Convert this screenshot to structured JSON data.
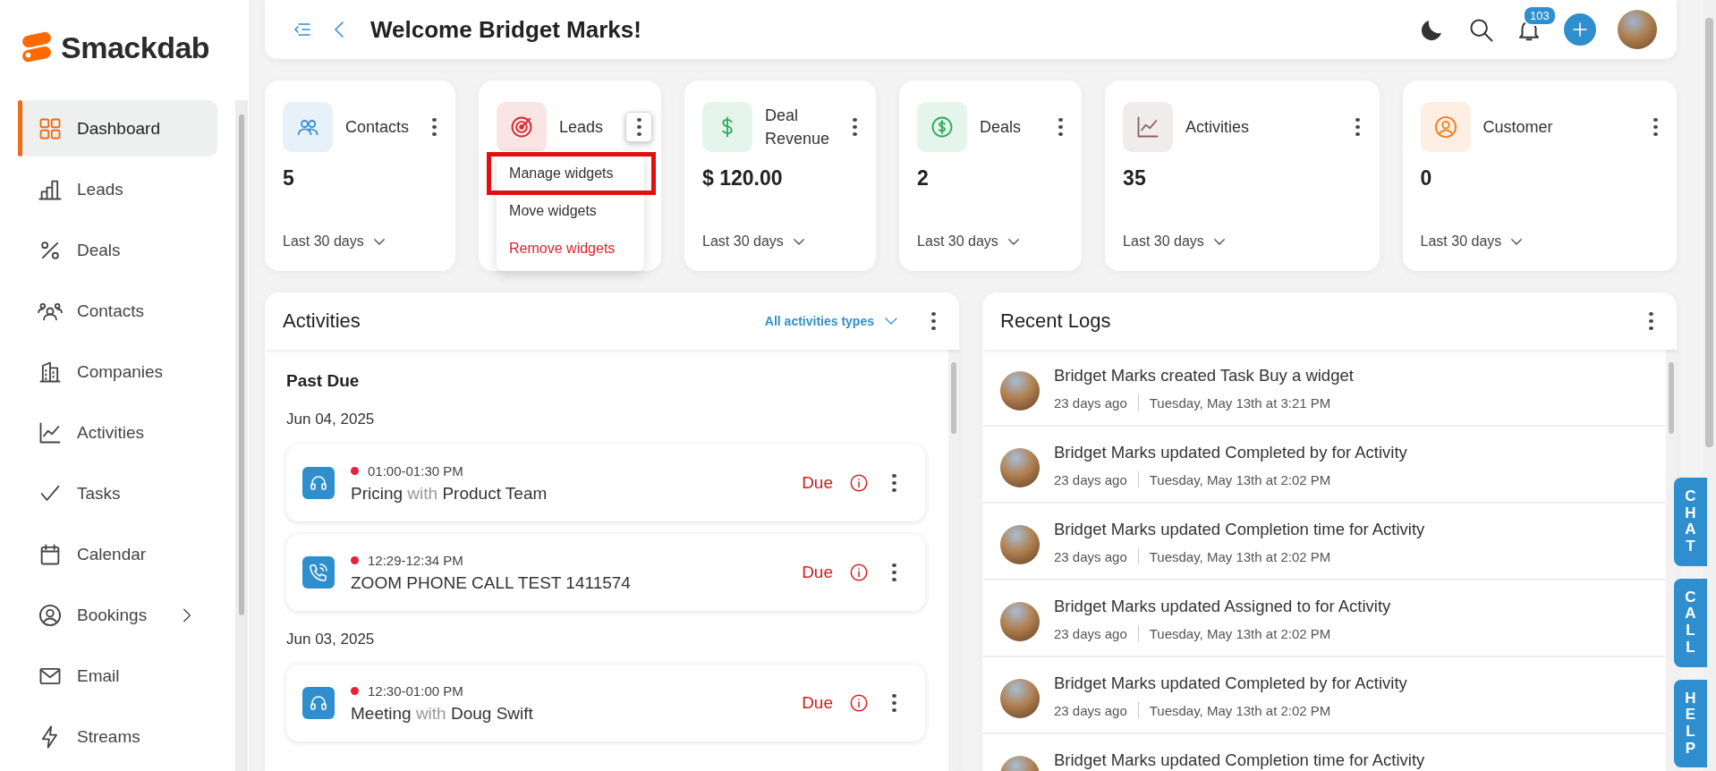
{
  "app": {
    "logo": "Smackdab"
  },
  "sidebar": {
    "items": [
      {
        "label": "Dashboard",
        "selected": true,
        "has_submenu": false
      },
      {
        "label": "Leads",
        "selected": false,
        "has_submenu": false
      },
      {
        "label": "Deals",
        "selected": false,
        "has_submenu": false
      },
      {
        "label": "Contacts",
        "selected": false,
        "has_submenu": false
      },
      {
        "label": "Companies",
        "selected": false,
        "has_submenu": false
      },
      {
        "label": "Activities",
        "selected": false,
        "has_submenu": false
      },
      {
        "label": "Tasks",
        "selected": false,
        "has_submenu": false
      },
      {
        "label": "Calendar",
        "selected": false,
        "has_submenu": false
      },
      {
        "label": "Bookings",
        "selected": false,
        "has_submenu": true
      },
      {
        "label": "Email",
        "selected": false,
        "has_submenu": false
      },
      {
        "label": "Streams",
        "selected": false,
        "has_submenu": false
      }
    ]
  },
  "header": {
    "title": "Welcome Bridget Marks!",
    "notification_count": "103"
  },
  "widgets": [
    {
      "title": "Contacts",
      "value": "5",
      "period": "Last 30 days",
      "color": "#3b8fd0",
      "menu_open": false
    },
    {
      "title": "Leads",
      "color": "#d9262d",
      "menu_open": true
    },
    {
      "title": "Deal Revenue",
      "value": "$ 120.00",
      "period": "Last 30 days",
      "color": "#2eaa5c",
      "menu_open": false
    },
    {
      "title": "Deals",
      "value": "2",
      "period": "Last 30 days",
      "color": "#2eaa5c",
      "menu_open": false
    },
    {
      "title": "Activities",
      "value": "35",
      "period": "Last 30 days",
      "color": "#8a6464",
      "menu_open": false
    },
    {
      "title": "Customer",
      "value": "0",
      "period": "Last 30 days",
      "color": "#f07f1e",
      "menu_open": false
    }
  ],
  "widget_menu": {
    "items": [
      {
        "label": "Manage widgets",
        "kind": "normal",
        "highlighted": true
      },
      {
        "label": "Move widgets",
        "kind": "normal",
        "highlighted": false
      },
      {
        "label": "Remove widgets",
        "kind": "danger",
        "highlighted": false
      }
    ]
  },
  "activities": {
    "title": "Activities",
    "filter": "All activities types",
    "section": "Past Due",
    "groups": [
      {
        "date": "Jun 04, 2025",
        "items": [
          {
            "kind": "meeting",
            "time": "01:00-01:30 PM",
            "subject": "Pricing",
            "joiner": "with",
            "contact": "Product Team",
            "status": "Due",
            "overdue": true
          },
          {
            "kind": "call",
            "time": "12:29-12:34 PM",
            "subject": "ZOOM PHONE CALL TEST 1411574",
            "status": "Due",
            "overdue": true
          }
        ]
      },
      {
        "date": "Jun 03, 2025",
        "items": [
          {
            "kind": "meeting",
            "time": "12:30-01:00 PM",
            "subject": "Meeting",
            "joiner": "with",
            "contact": "Doug Swift",
            "status": "Due",
            "overdue": true
          }
        ]
      }
    ]
  },
  "recent_logs": {
    "title": "Recent Logs",
    "items": [
      {
        "text": "Bridget Marks created Task Buy a widget",
        "ago": "23 days ago",
        "time": "Tuesday, May 13th at 3:21 PM"
      },
      {
        "text": "Bridget Marks updated Completed by for Activity",
        "ago": "23 days ago",
        "time": "Tuesday, May 13th at 2:02 PM"
      },
      {
        "text": "Bridget Marks updated Completion time for Activity",
        "ago": "23 days ago",
        "time": "Tuesday, May 13th at 2:02 PM"
      },
      {
        "text": "Bridget Marks updated Assigned to for Activity",
        "ago": "23 days ago",
        "time": "Tuesday, May 13th at 2:02 PM"
      },
      {
        "text": "Bridget Marks updated Completed by for Activity",
        "ago": "23 days ago",
        "time": "Tuesday, May 13th at 2:02 PM"
      },
      {
        "text": "Bridget Marks updated Completion time for Activity"
      }
    ]
  },
  "side_tabs": [
    "CHAT",
    "CALL",
    "HELP"
  ]
}
